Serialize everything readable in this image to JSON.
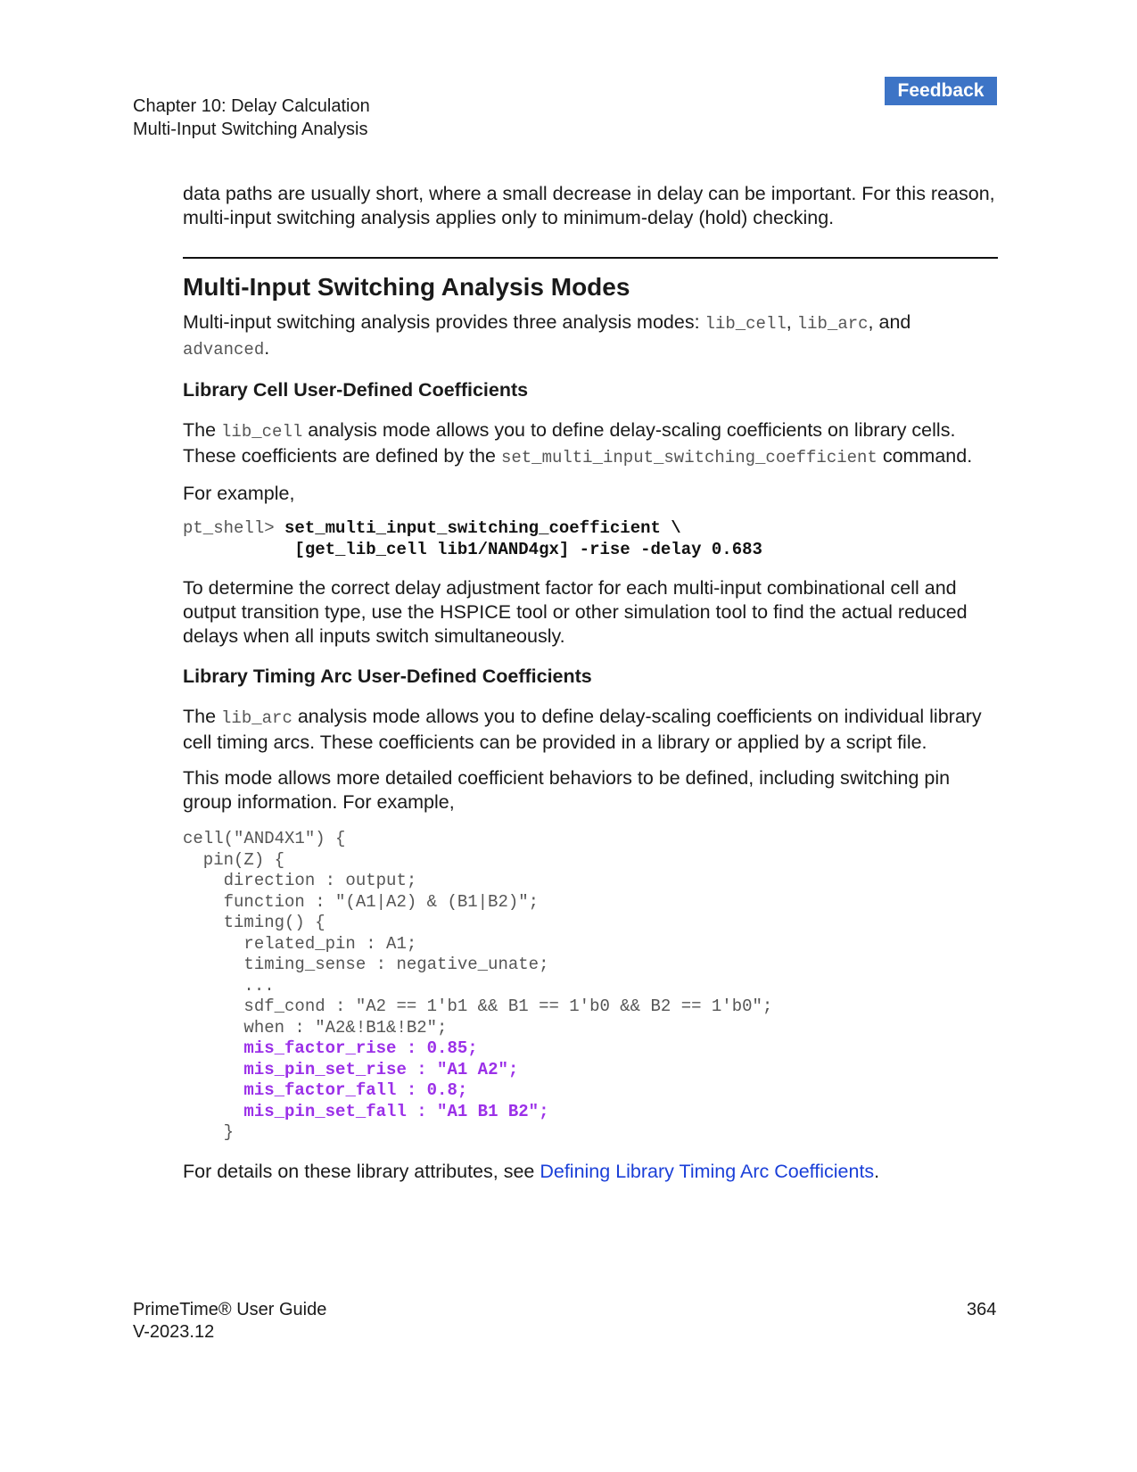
{
  "feedback_label": "Feedback",
  "header": {
    "chapter": "Chapter 10: Delay Calculation",
    "section": "Multi-Input Switching Analysis"
  },
  "body": {
    "intro": "data paths are usually short, where a small decrease in delay can be important. For this reason, multi-input switching analysis applies only to minimum-delay (hold) checking.",
    "h2": "Multi-Input Switching Analysis Modes",
    "modes_text_1": "Multi-input switching analysis provides three analysis modes: ",
    "modes_code_1": "lib_cell",
    "modes_sep_1": ", ",
    "modes_code_2": "lib_arc",
    "modes_sep_2": ", and ",
    "modes_code_3": "advanced",
    "modes_end": ".",
    "h3_cell": "Library Cell User-Defined Coefficients",
    "cell_p1_a": "The ",
    "cell_p1_code": "lib_cell",
    "cell_p1_b": " analysis mode allows you to define delay-scaling coefficients on library cells. These coefficients are defined by the ",
    "cell_p1_code2": "set_multi_input_switching_coefficient",
    "cell_p1_c": " command.",
    "for_example": "For example,",
    "cmd_prompt": "pt_shell> ",
    "cmd_line1": "set_multi_input_switching_coefficient \\",
    "cmd_indent": "           ",
    "cmd_line2": "[get_lib_cell lib1/NAND4gx] -rise -delay 0.683",
    "determine_p": "To determine the correct delay adjustment factor for each multi-input combinational cell and output transition type, use the HSPICE tool or other simulation tool to find the actual reduced delays when all inputs switch simultaneously.",
    "h3_arc": "Library Timing Arc User-Defined Coefficients",
    "arc_p1_a": "The ",
    "arc_p1_code": "lib_arc",
    "arc_p1_b": " analysis mode allows you to define delay-scaling coefficients on individual library cell timing arcs. These coefficients can be provided in a library or applied by a script file.",
    "arc_p2": "This mode allows more detailed coefficient behaviors to be defined, including switching pin group information. For example,",
    "code_plain": [
      "cell(\"AND4X1\") {",
      "  pin(Z) {",
      "    direction : output;",
      "    function : \"(A1|A2) & (B1|B2)\";",
      "    timing() {",
      "      related_pin : A1;",
      "      timing_sense : negative_unate;",
      "      ...",
      "      sdf_cond : \"A2 == 1'b1 && B1 == 1'b0 && B2 == 1'b0\";",
      "      when : \"A2&!B1&!B2\";"
    ],
    "code_indent": "      ",
    "code_hl": [
      "mis_factor_rise : 0.85;",
      "mis_pin_set_rise : \"A1 A2\";",
      "mis_factor_fall : 0.8;",
      "mis_pin_set_fall : \"A1 B1 B2\";"
    ],
    "code_close": "    }",
    "details_a": "For details on these library attributes, see ",
    "details_link": "Defining Library Timing Arc Coefficients",
    "details_b": "."
  },
  "footer": {
    "product": "PrimeTime® User Guide",
    "version": "V-2023.12",
    "page": "364"
  }
}
